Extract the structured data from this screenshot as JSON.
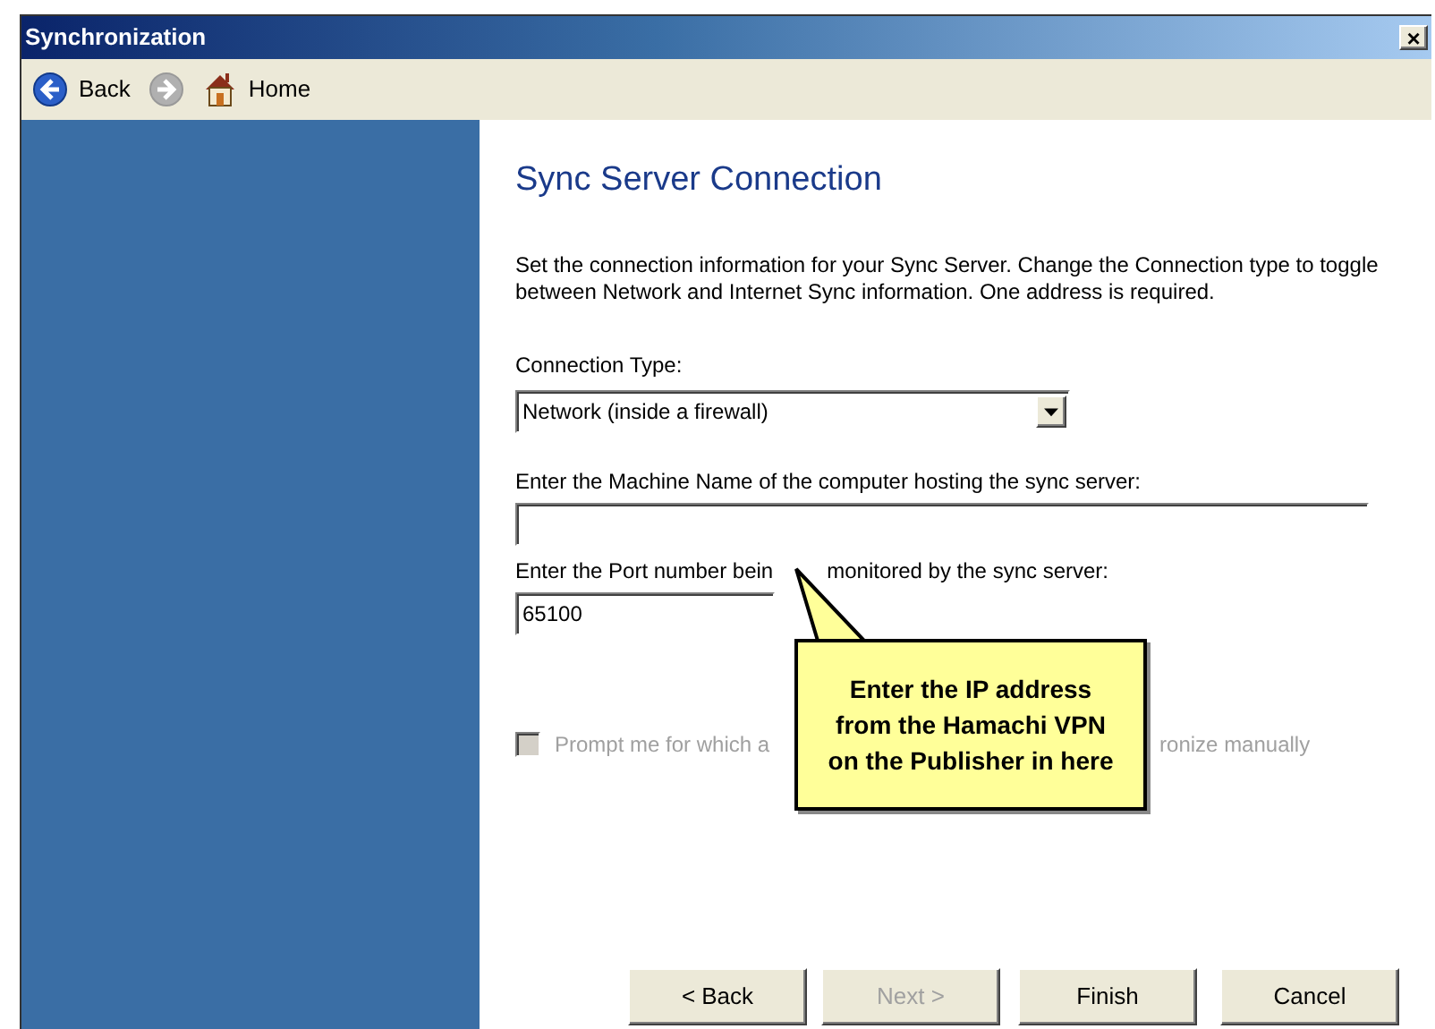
{
  "window": {
    "title": "Synchronization",
    "close": "×"
  },
  "toolbar": [
    {
      "kind": "back",
      "label": "Back",
      "disabled": false
    },
    {
      "kind": "forward",
      "disabled": true
    },
    {
      "kind": "home",
      "label": "Home",
      "disabled": false
    }
  ],
  "page": {
    "heading": "Sync Server Connection",
    "description": "Set the connection information for your Sync Server. Change the Connection type to toggle between Network and Internet Sync information. One address is required.",
    "connection_type": {
      "label": "Connection Type:",
      "value": "Network (inside a firewall)"
    },
    "machine_name": {
      "label": "Enter the Machine Name of the computer hosting the sync server:"
    },
    "port": {
      "label_parts": [
        "Enter the Port number bein",
        "monitored by the sync server:"
      ],
      "value": "65100"
    },
    "prompt_checkbox": {
      "label_parts": [
        "Prompt me for which a",
        "ronize manually"
      ],
      "checked": false,
      "disabled": true
    }
  },
  "callout": {
    "text": "Enter the IP address from the Hamachi VPN on the Publisher in here"
  },
  "buttons": [
    {
      "label": "< Back",
      "disabled": false
    },
    {
      "label": "Next >",
      "disabled": true
    },
    {
      "label": "Finish",
      "disabled": false
    },
    {
      "label": "Cancel",
      "disabled": false
    }
  ]
}
